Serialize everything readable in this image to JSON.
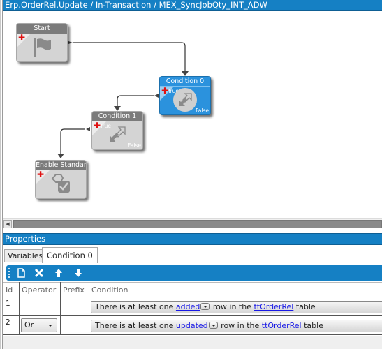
{
  "window": {
    "title": "Erp.OrderRel.Update / In-Transaction / MEX_SyncJobQty_INT_ADW"
  },
  "workflow": {
    "nodes": [
      {
        "id": "start",
        "label": "Start",
        "icon": "flag-icon",
        "selected": false
      },
      {
        "id": "condition-0",
        "label": "Condition 0",
        "icon": "condition-arrows-icon",
        "true_label": "True",
        "false_label": "False",
        "selected": true
      },
      {
        "id": "condition-1",
        "label": "Condition 1",
        "icon": "condition-arrows-icon",
        "true_label": "True",
        "false_label": "False",
        "selected": false
      },
      {
        "id": "enable-standard",
        "label": "Enable Standard D",
        "icon": "enable-checkbox-icon",
        "selected": false
      }
    ],
    "connections": [
      {
        "from": "start",
        "to": "condition-0"
      },
      {
        "from": "condition-0",
        "branch": "True",
        "to": "condition-1"
      },
      {
        "from": "condition-1",
        "branch": "True",
        "to": "enable-standard"
      }
    ]
  },
  "properties": {
    "title": "Properties",
    "tabs": [
      {
        "label": "Variables",
        "active": false
      },
      {
        "label": "Condition 0",
        "active": true
      }
    ],
    "toolbar": {
      "buttons": [
        {
          "name": "new-icon",
          "tooltip": "New"
        },
        {
          "name": "delete-icon",
          "tooltip": "Delete"
        },
        {
          "name": "move-up-icon",
          "tooltip": "Move Up"
        },
        {
          "name": "move-down-icon",
          "tooltip": "Move Down"
        }
      ]
    },
    "grid": {
      "columns": [
        "Id",
        "Operator",
        "Prefix",
        "Condition"
      ],
      "rows": [
        {
          "id": "1",
          "operator": "",
          "prefix": "",
          "condition": {
            "pre": "There is at least one ",
            "link1": "added",
            "mid": " row in the ",
            "link2": "ttOrderRel",
            "post": " table"
          }
        },
        {
          "id": "2",
          "operator": "Or",
          "prefix": "",
          "condition": {
            "pre": "There is at least one ",
            "link1": "updated",
            "mid": " row in the ",
            "link2": "ttOrderRel",
            "post": " table"
          }
        }
      ]
    }
  },
  "colors": {
    "accent": "#1580c4",
    "selected_node": "#2b92dd",
    "node_gray": "#d4d4d4",
    "link": "#1a1ae6"
  }
}
